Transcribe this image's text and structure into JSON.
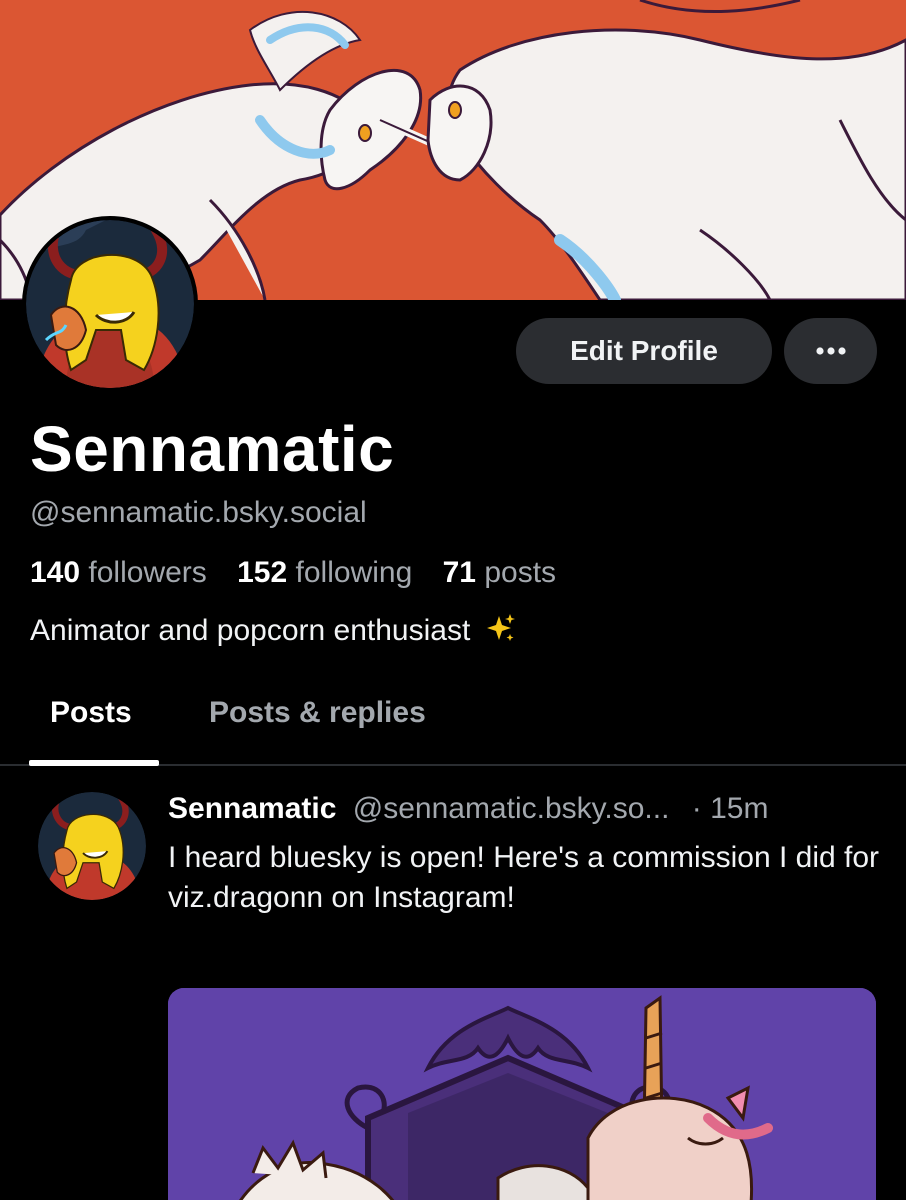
{
  "profile": {
    "display_name": "Sennamatic",
    "handle": "@sennamatic.bsky.social",
    "followers_count": "140",
    "followers_label": "followers",
    "following_count": "152",
    "following_label": "following",
    "posts_count": "71",
    "posts_label": "posts",
    "bio": "Animator and popcorn enthusiast"
  },
  "actions": {
    "edit_label": "Edit Profile",
    "more_icon": "ellipsis-icon"
  },
  "tabs": [
    {
      "label": "Posts",
      "active": true
    },
    {
      "label": "Posts & replies",
      "active": false
    }
  ],
  "post": {
    "author": "Sennamatic",
    "handle": "@sennamatic.bsky.so...",
    "time": "· 15m",
    "text": "I heard bluesky is open! Here's a commission I did for viz.dragonn on Instagram!"
  },
  "colors": {
    "background": "#000000",
    "button_bg": "#2b2d31",
    "muted_text": "#a3a8ae",
    "banner_red": "#d9502f",
    "post_image_purple": "#5b3fa2"
  }
}
